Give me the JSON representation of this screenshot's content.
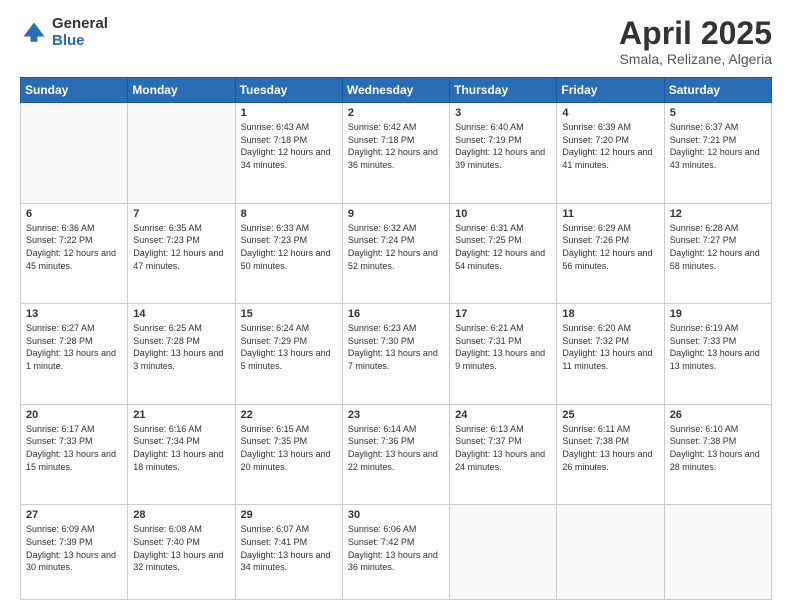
{
  "logo": {
    "general": "General",
    "blue": "Blue"
  },
  "header": {
    "month": "April 2025",
    "location": "Smala, Relizane, Algeria"
  },
  "weekdays": [
    "Sunday",
    "Monday",
    "Tuesday",
    "Wednesday",
    "Thursday",
    "Friday",
    "Saturday"
  ],
  "weeks": [
    [
      {
        "day": "",
        "sunrise": "",
        "sunset": "",
        "daylight": ""
      },
      {
        "day": "",
        "sunrise": "",
        "sunset": "",
        "daylight": ""
      },
      {
        "day": "1",
        "sunrise": "Sunrise: 6:43 AM",
        "sunset": "Sunset: 7:18 PM",
        "daylight": "Daylight: 12 hours and 34 minutes."
      },
      {
        "day": "2",
        "sunrise": "Sunrise: 6:42 AM",
        "sunset": "Sunset: 7:18 PM",
        "daylight": "Daylight: 12 hours and 36 minutes."
      },
      {
        "day": "3",
        "sunrise": "Sunrise: 6:40 AM",
        "sunset": "Sunset: 7:19 PM",
        "daylight": "Daylight: 12 hours and 39 minutes."
      },
      {
        "day": "4",
        "sunrise": "Sunrise: 6:39 AM",
        "sunset": "Sunset: 7:20 PM",
        "daylight": "Daylight: 12 hours and 41 minutes."
      },
      {
        "day": "5",
        "sunrise": "Sunrise: 6:37 AM",
        "sunset": "Sunset: 7:21 PM",
        "daylight": "Daylight: 12 hours and 43 minutes."
      }
    ],
    [
      {
        "day": "6",
        "sunrise": "Sunrise: 6:36 AM",
        "sunset": "Sunset: 7:22 PM",
        "daylight": "Daylight: 12 hours and 45 minutes."
      },
      {
        "day": "7",
        "sunrise": "Sunrise: 6:35 AM",
        "sunset": "Sunset: 7:23 PM",
        "daylight": "Daylight: 12 hours and 47 minutes."
      },
      {
        "day": "8",
        "sunrise": "Sunrise: 6:33 AM",
        "sunset": "Sunset: 7:23 PM",
        "daylight": "Daylight: 12 hours and 50 minutes."
      },
      {
        "day": "9",
        "sunrise": "Sunrise: 6:32 AM",
        "sunset": "Sunset: 7:24 PM",
        "daylight": "Daylight: 12 hours and 52 minutes."
      },
      {
        "day": "10",
        "sunrise": "Sunrise: 6:31 AM",
        "sunset": "Sunset: 7:25 PM",
        "daylight": "Daylight: 12 hours and 54 minutes."
      },
      {
        "day": "11",
        "sunrise": "Sunrise: 6:29 AM",
        "sunset": "Sunset: 7:26 PM",
        "daylight": "Daylight: 12 hours and 56 minutes."
      },
      {
        "day": "12",
        "sunrise": "Sunrise: 6:28 AM",
        "sunset": "Sunset: 7:27 PM",
        "daylight": "Daylight: 12 hours and 58 minutes."
      }
    ],
    [
      {
        "day": "13",
        "sunrise": "Sunrise: 6:27 AM",
        "sunset": "Sunset: 7:28 PM",
        "daylight": "Daylight: 13 hours and 1 minute."
      },
      {
        "day": "14",
        "sunrise": "Sunrise: 6:25 AM",
        "sunset": "Sunset: 7:28 PM",
        "daylight": "Daylight: 13 hours and 3 minutes."
      },
      {
        "day": "15",
        "sunrise": "Sunrise: 6:24 AM",
        "sunset": "Sunset: 7:29 PM",
        "daylight": "Daylight: 13 hours and 5 minutes."
      },
      {
        "day": "16",
        "sunrise": "Sunrise: 6:23 AM",
        "sunset": "Sunset: 7:30 PM",
        "daylight": "Daylight: 13 hours and 7 minutes."
      },
      {
        "day": "17",
        "sunrise": "Sunrise: 6:21 AM",
        "sunset": "Sunset: 7:31 PM",
        "daylight": "Daylight: 13 hours and 9 minutes."
      },
      {
        "day": "18",
        "sunrise": "Sunrise: 6:20 AM",
        "sunset": "Sunset: 7:32 PM",
        "daylight": "Daylight: 13 hours and 11 minutes."
      },
      {
        "day": "19",
        "sunrise": "Sunrise: 6:19 AM",
        "sunset": "Sunset: 7:33 PM",
        "daylight": "Daylight: 13 hours and 13 minutes."
      }
    ],
    [
      {
        "day": "20",
        "sunrise": "Sunrise: 6:17 AM",
        "sunset": "Sunset: 7:33 PM",
        "daylight": "Daylight: 13 hours and 15 minutes."
      },
      {
        "day": "21",
        "sunrise": "Sunrise: 6:16 AM",
        "sunset": "Sunset: 7:34 PM",
        "daylight": "Daylight: 13 hours and 18 minutes."
      },
      {
        "day": "22",
        "sunrise": "Sunrise: 6:15 AM",
        "sunset": "Sunset: 7:35 PM",
        "daylight": "Daylight: 13 hours and 20 minutes."
      },
      {
        "day": "23",
        "sunrise": "Sunrise: 6:14 AM",
        "sunset": "Sunset: 7:36 PM",
        "daylight": "Daylight: 13 hours and 22 minutes."
      },
      {
        "day": "24",
        "sunrise": "Sunrise: 6:13 AM",
        "sunset": "Sunset: 7:37 PM",
        "daylight": "Daylight: 13 hours and 24 minutes."
      },
      {
        "day": "25",
        "sunrise": "Sunrise: 6:11 AM",
        "sunset": "Sunset: 7:38 PM",
        "daylight": "Daylight: 13 hours and 26 minutes."
      },
      {
        "day": "26",
        "sunrise": "Sunrise: 6:10 AM",
        "sunset": "Sunset: 7:38 PM",
        "daylight": "Daylight: 13 hours and 28 minutes."
      }
    ],
    [
      {
        "day": "27",
        "sunrise": "Sunrise: 6:09 AM",
        "sunset": "Sunset: 7:39 PM",
        "daylight": "Daylight: 13 hours and 30 minutes."
      },
      {
        "day": "28",
        "sunrise": "Sunrise: 6:08 AM",
        "sunset": "Sunset: 7:40 PM",
        "daylight": "Daylight: 13 hours and 32 minutes."
      },
      {
        "day": "29",
        "sunrise": "Sunrise: 6:07 AM",
        "sunset": "Sunset: 7:41 PM",
        "daylight": "Daylight: 13 hours and 34 minutes."
      },
      {
        "day": "30",
        "sunrise": "Sunrise: 6:06 AM",
        "sunset": "Sunset: 7:42 PM",
        "daylight": "Daylight: 13 hours and 36 minutes."
      },
      {
        "day": "",
        "sunrise": "",
        "sunset": "",
        "daylight": ""
      },
      {
        "day": "",
        "sunrise": "",
        "sunset": "",
        "daylight": ""
      },
      {
        "day": "",
        "sunrise": "",
        "sunset": "",
        "daylight": ""
      }
    ]
  ]
}
